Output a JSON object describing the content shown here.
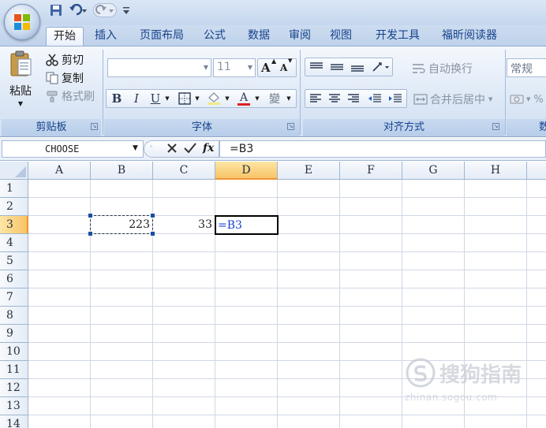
{
  "quick_access": {
    "save_icon": "save-icon",
    "undo_icon": "undo-icon",
    "redo_icon": "redo-icon",
    "customize_glyph": "₹"
  },
  "tabs": [
    "开始",
    "插入",
    "页面布局",
    "公式",
    "数据",
    "审阅",
    "视图",
    "开发工具",
    "福昕阅读器"
  ],
  "active_tab": "开始",
  "ribbon": {
    "clipboard": {
      "paste": "粘贴",
      "cut": "剪切",
      "copy": "复制",
      "format_painter": "格式刷",
      "caption": "剪贴板"
    },
    "font": {
      "font_name": "",
      "font_size": "11",
      "grow": "A",
      "shrink": "A",
      "bold": "B",
      "italic": "I",
      "underline": "U",
      "font_color_letter": "A",
      "phonetic": "變",
      "caption": "字体"
    },
    "alignment": {
      "wrap_text": "自动换行",
      "merge_center": "合并后居中",
      "caption": "对齐方式"
    },
    "number": {
      "format": "常规",
      "percent": "%",
      "caption_partial": "数"
    }
  },
  "formula_bar": {
    "name_box": "CHOOSE",
    "formula": "=B3"
  },
  "grid": {
    "columns": [
      "A",
      "B",
      "C",
      "D",
      "E",
      "F",
      "G",
      "H"
    ],
    "selected_column": "D",
    "rows": [
      "1",
      "2",
      "3",
      "4",
      "5",
      "6",
      "7",
      "8",
      "9",
      "10",
      "11",
      "12",
      "13",
      "14"
    ],
    "selected_row": "3",
    "cells": {
      "B3": "223",
      "C3": "33",
      "D3": "=B3"
    }
  },
  "watermark": {
    "title": "搜狗指南",
    "url": "zhinan.sogou.com"
  },
  "colors": {
    "tab_text": "#15428b",
    "formula_ref": "#1a40d0",
    "selected_header": "#f7c466"
  }
}
